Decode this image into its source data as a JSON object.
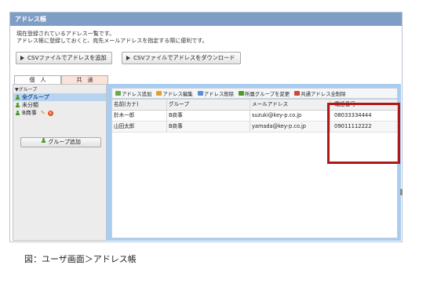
{
  "window": {
    "title": "アドレス帳"
  },
  "description": [
    "現在登録されているアドレス一覧です。",
    "アドレス帳に登録しておくと、宛先メールアドレスを指定する際に便利です。"
  ],
  "buttons": {
    "import_csv": "CSVファイルでアドレスを追加",
    "export_csv": "CSVファイルでアドレスをダウンロード"
  },
  "tabs": {
    "personal": "個　人",
    "shared": "共　通"
  },
  "sidebar": {
    "tree_head": "▼グループ",
    "items": [
      {
        "label": "全グループ"
      },
      {
        "label": "未分類"
      },
      {
        "label": "B商事"
      }
    ],
    "group_add": "グループ追加"
  },
  "toolbar": {
    "add_address": "アドレス追加",
    "edit_address": "アドレス編集",
    "delete_address": "アドレス削除",
    "change_group": "所属グループを変更",
    "delete_all_shared": "共通アドレス全削除"
  },
  "table": {
    "headers": {
      "name": "名前(カナ)",
      "group": "グループ",
      "email": "メールアドレス",
      "phone": "電話番号"
    },
    "rows": [
      {
        "name": "鈴木一郎",
        "group": "B商事",
        "email": "suzuki@key-p.co.jp",
        "phone": "08033334444"
      },
      {
        "name": "山田太郎",
        "group": "B商事",
        "email": "yamada@key-p.co.jp",
        "phone": "09011112222"
      }
    ]
  },
  "caption": "図：ユーザ画面＞アドレス帳",
  "colors": {
    "titlebar": "#7f9ec6",
    "panel": "#a8cdf1",
    "highlight": "#b01818"
  }
}
